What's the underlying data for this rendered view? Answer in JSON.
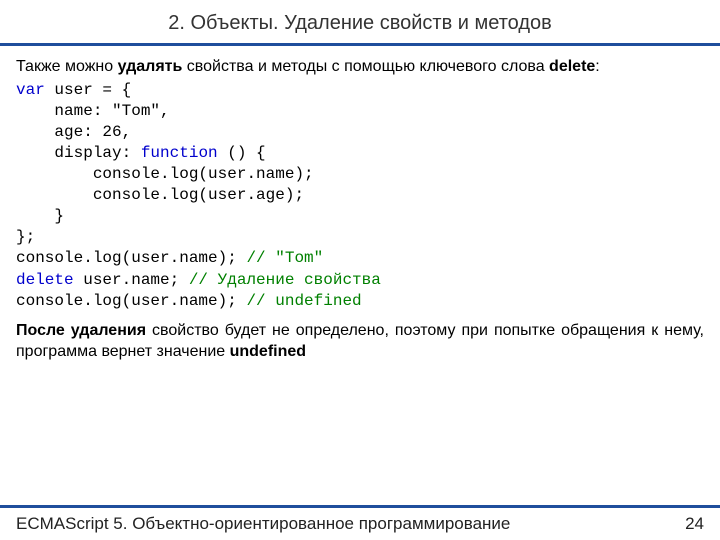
{
  "title": "2. Объекты. Удаление свойств и методов",
  "intro": {
    "t1": "Также можно ",
    "b1": "удалять",
    "t2": " свойства и методы с помощью ключевого слова ",
    "b2": "delete",
    "t3": ":"
  },
  "code": {
    "l1a": "var",
    "l1b": " user = {",
    "l2": "    name: \"Tom\",",
    "l3": "    age: 26,",
    "l4a": "    display: ",
    "l4b": "function",
    "l4c": " () {",
    "l5": "        console.log(user.name);",
    "l6": "        console.log(user.age);",
    "l7": "    }",
    "l8": "};",
    "l9a": "console.log(user.name); ",
    "l9b": "// \"Tom\"",
    "l10a": "delete",
    "l10b": " user.name; ",
    "l10c": "// Удаление свойства",
    "l11a": "console.log(user.name); ",
    "l11b": "// undefined"
  },
  "outro": {
    "b1": "После удаления",
    "t1": " свойство будет не определено, поэтому при попытке обращения к нему, программа вернет значение ",
    "b2": "undefined"
  },
  "footer": {
    "left": "ECMAScript 5. Объектно-ориентированное программирование",
    "page": "24"
  }
}
